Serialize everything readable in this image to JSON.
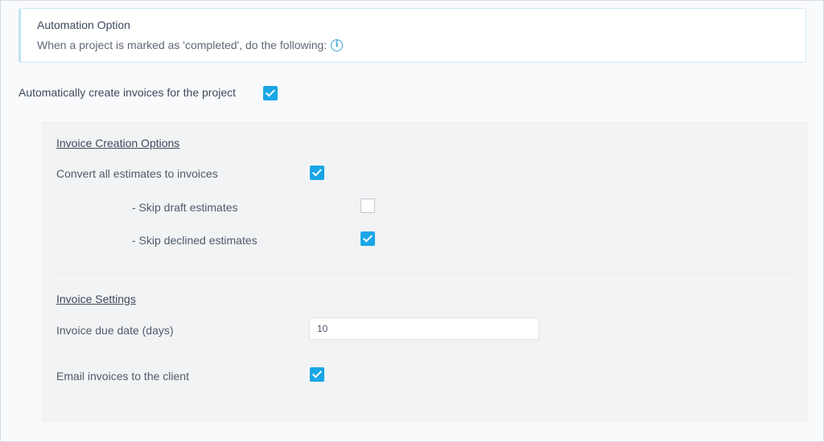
{
  "automation": {
    "title": "Automation Option",
    "description": "When a project is marked as 'completed', do the following:",
    "info_icon": "info-circle-icon"
  },
  "auto_create": {
    "label": "Automatically create invoices for the project",
    "checked": true
  },
  "invoice_creation": {
    "heading": "Invoice Creation Options",
    "convert_label": "Convert all estimates to invoices",
    "convert_checked": true,
    "skip_draft_label": "- Skip draft estimates",
    "skip_draft_checked": false,
    "skip_declined_label": "- Skip declined estimates",
    "skip_declined_checked": true
  },
  "invoice_settings": {
    "heading": "Invoice Settings",
    "due_date_label": "Invoice due date (days)",
    "due_date_value": "10",
    "email_label": "Email invoices to the client",
    "email_checked": true
  },
  "colors": {
    "accent": "#1aa6e6",
    "info_border": "#cfe7f0",
    "panel_bg": "#f2f3f4"
  }
}
